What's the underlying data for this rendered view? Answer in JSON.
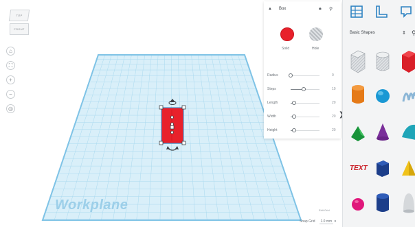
{
  "view_cube": {
    "top": "TOP",
    "front": "FRONT"
  },
  "view_controls": [
    {
      "name": "home-view-button",
      "glyph": "⌂"
    },
    {
      "name": "fit-view-button",
      "glyph": "⛶"
    },
    {
      "name": "zoom-in-button",
      "glyph": "+"
    },
    {
      "name": "zoom-out-button",
      "glyph": "−"
    },
    {
      "name": "ortho-view-button",
      "glyph": "◎"
    }
  ],
  "workplane": {
    "label": "Workplane",
    "edit_grid": "Edit Grid",
    "snap_grid_label": "Snap Grid",
    "snap_grid_value": "1.0 mm"
  },
  "inspector": {
    "title": "Box",
    "solid_label": "Solid",
    "hole_label": "Hole",
    "solid_color": "#e8212b",
    "params": [
      {
        "label": "Radius",
        "value": "0",
        "fraction": 0.0
      },
      {
        "label": "Steps",
        "value": "10",
        "fraction": 0.45
      },
      {
        "label": "Length",
        "value": "20",
        "fraction": 0.12
      },
      {
        "label": "Width",
        "value": "20",
        "fraction": 0.12
      },
      {
        "label": "Height",
        "value": "20",
        "fraction": 0.12
      }
    ]
  },
  "panel_toggle": "❯",
  "shapes_panel": {
    "category": "Basic Shapes",
    "shapes": [
      "box-hole",
      "cylinder-hole",
      "box",
      "cylinder",
      "sphere",
      "scribble",
      "roof",
      "cone",
      "round-roof",
      "text",
      "cube-prism",
      "pyramid",
      "half-sphere",
      "polygon",
      "paraboloid"
    ]
  }
}
